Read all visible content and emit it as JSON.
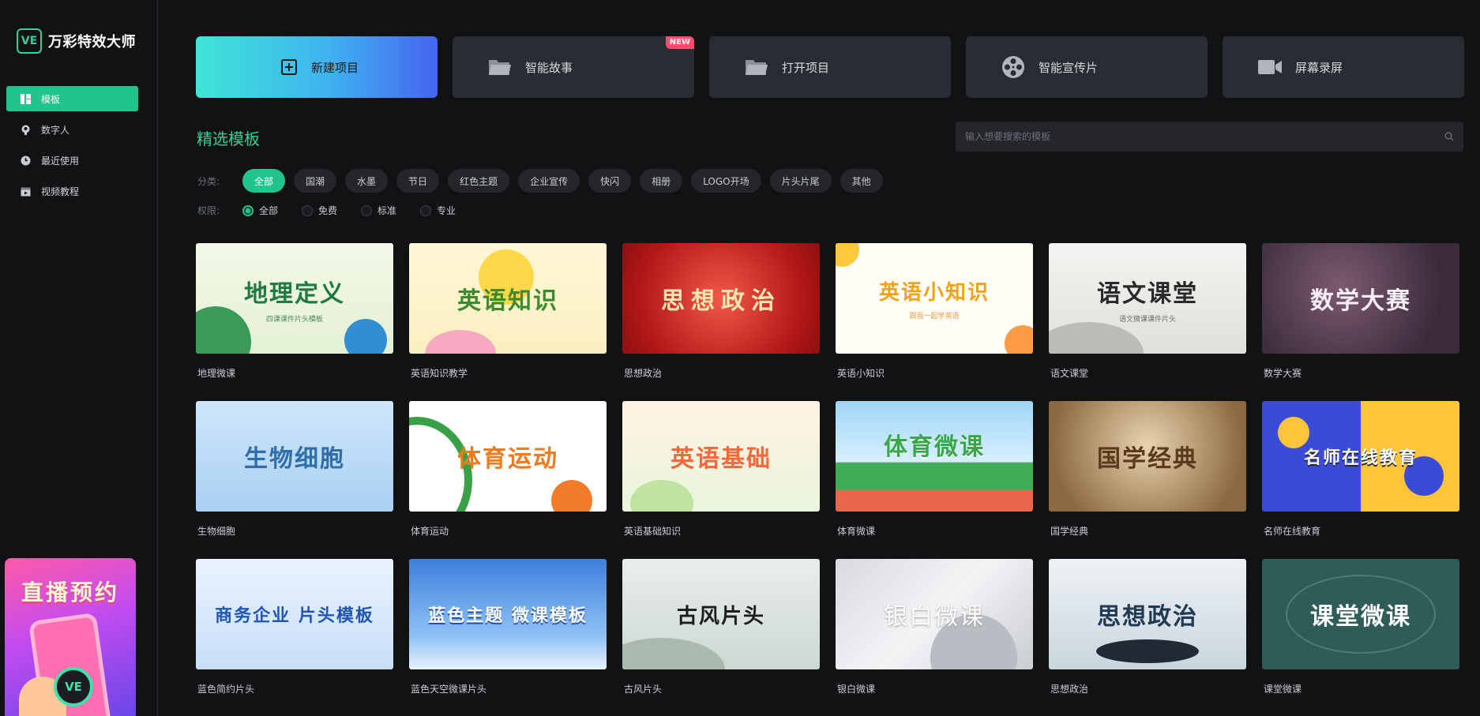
{
  "brand": {
    "logo": "VE",
    "name": "万彩特效大师"
  },
  "sidebar": {
    "items": [
      {
        "label": "模板",
        "icon": "template-icon",
        "active": true
      },
      {
        "label": "数字人",
        "icon": "person-icon",
        "active": false
      },
      {
        "label": "最近使用",
        "icon": "clock-icon",
        "active": false
      },
      {
        "label": "视频教程",
        "icon": "video-tutorial-icon",
        "active": false
      }
    ],
    "promo": {
      "title": "直播预约",
      "badge": "VE"
    }
  },
  "actions": [
    {
      "label": "新建项目",
      "icon": "plus-square-icon",
      "primary": true
    },
    {
      "label": "智能故事",
      "icon": "folder-icon",
      "badge": "NEW"
    },
    {
      "label": "打开项目",
      "icon": "folder-icon"
    },
    {
      "label": "智能宣传片",
      "icon": "film-reel-icon"
    },
    {
      "label": "屏幕录屏",
      "icon": "video-camera-icon"
    }
  ],
  "section": {
    "title": "精选模板"
  },
  "search": {
    "placeholder": "输入想要搜索的模板"
  },
  "filters": {
    "category_label": "分类:",
    "categories": [
      "全部",
      "国潮",
      "水墨",
      "节日",
      "红色主题",
      "企业宣传",
      "快闪",
      "相册",
      "LOGO开场",
      "片头片尾",
      "其他"
    ],
    "active_category": "全部",
    "permission_label": "权限:",
    "permissions": [
      "全部",
      "免费",
      "标准",
      "专业"
    ],
    "active_permission": "全部"
  },
  "templates": [
    {
      "name": "地理微课",
      "thumb_title": "地理定义",
      "thumb_sub": "四课课件片头模板"
    },
    {
      "name": "英语知识教学",
      "thumb_title": "英语知识",
      "thumb_sub": ""
    },
    {
      "name": "思想政治",
      "thumb_title": "思想政治",
      "thumb_sub": ""
    },
    {
      "name": "英语小知识",
      "thumb_title": "英语小知识",
      "thumb_sub": "跟我一起学英语"
    },
    {
      "name": "语文课堂",
      "thumb_title": "语文课堂",
      "thumb_sub": "语文微课课件片头"
    },
    {
      "name": "数学大赛",
      "thumb_title": "数学大赛",
      "thumb_sub": ""
    },
    {
      "name": "生物细胞",
      "thumb_title": "生物细胞",
      "thumb_sub": ""
    },
    {
      "name": "体育运动",
      "thumb_title": "体育运动",
      "thumb_sub": ""
    },
    {
      "name": "英语基础知识",
      "thumb_title": "英语基础",
      "thumb_sub": ""
    },
    {
      "name": "体育微课",
      "thumb_title": "体育微课",
      "thumb_sub": ""
    },
    {
      "name": "国学经典",
      "thumb_title": "国学经典",
      "thumb_sub": ""
    },
    {
      "name": "名师在线教育",
      "thumb_title": "名师在线教育",
      "thumb_sub": ""
    },
    {
      "name": "蓝色简约片头",
      "thumb_title": "商务企业 片头模板",
      "thumb_sub": ""
    },
    {
      "name": "蓝色天空微课片头",
      "thumb_title": "蓝色主题 微课模板",
      "thumb_sub": ""
    },
    {
      "name": "古风片头",
      "thumb_title": "古风片头",
      "thumb_sub": ""
    },
    {
      "name": "银白微课",
      "thumb_title": "银白微课",
      "thumb_sub": ""
    },
    {
      "name": "思想政治",
      "thumb_title": "思想政治",
      "thumb_sub": ""
    },
    {
      "name": "课堂微课",
      "thumb_title": "课堂微课",
      "thumb_sub": ""
    }
  ],
  "colors": {
    "accent": "#22c48d",
    "title_green": "#2fd39a",
    "background": "#111214",
    "card": "#2a2c33"
  }
}
